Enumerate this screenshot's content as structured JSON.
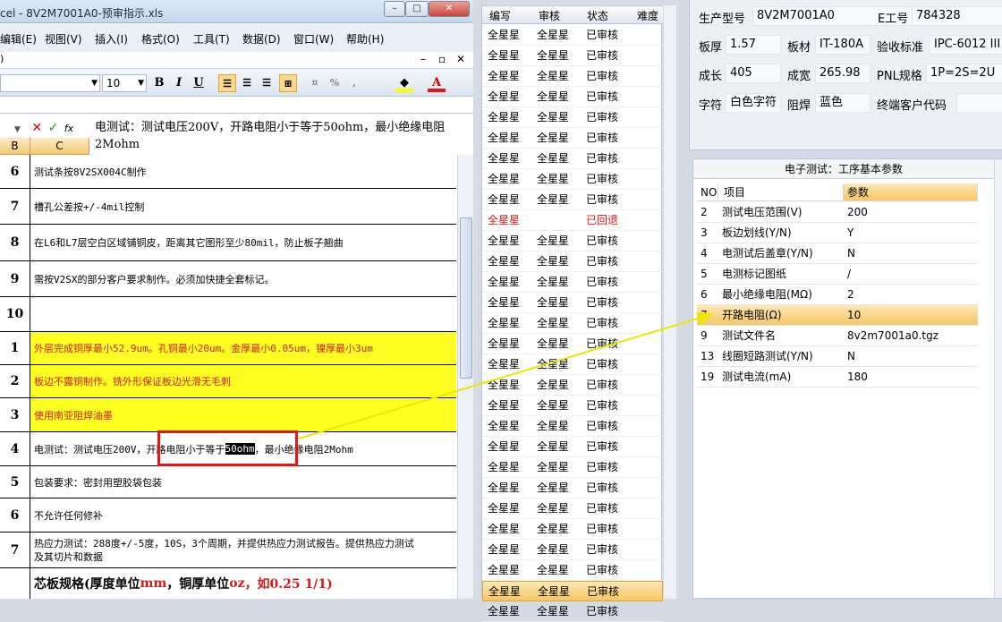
{
  "excel": {
    "title": "cel - 8V2M7001A0-预审指示.xls",
    "menus": [
      "编辑(E)",
      "视图(V)",
      "插入(I)",
      "格式(O)",
      "工具(T)",
      "数据(D)",
      "窗口(W)",
      "帮助(H)"
    ],
    "font_size": "10",
    "formula_text": "电测试：测试电压200V，开路电阻小于等于50ohm，最小绝缘电阻2Mohm",
    "col_b": "B",
    "col_c": "C",
    "rows": [
      {
        "num": "6",
        "text": "测试条按8V2SX004C制作"
      },
      {
        "num": "7",
        "text": "槽孔公差按+/-4mil控制"
      },
      {
        "num": "8",
        "text": "在L6和L7层空白区域铺铜皮，距离其它图形至少80mil，防止板子翘曲"
      },
      {
        "num": "9",
        "text": "需按V2SX的部分客户要求制作。必须加快捷全套标记。"
      },
      {
        "num": "10",
        "text": ""
      },
      {
        "num": "1",
        "text": "外层完成铜厚最小52.9um。孔铜最小20um。金厚最小0.05um，镍厚最小3um"
      },
      {
        "num": "2",
        "text": "板边不露铜制作。铣外形保证板边光滑无毛刺"
      },
      {
        "num": "3",
        "text": "使用南亚阻焊油墨"
      },
      {
        "num": "4",
        "text_a": "电测试：测试电压200V，开路电阻小于等于",
        "text_hl": "50ohm",
        "text_b": "，最小绝缘电阻2Mohm"
      },
      {
        "num": "5",
        "text": "包装要求：密封用塑胶袋包装"
      },
      {
        "num": "6",
        "text": "不允许任何修补"
      },
      {
        "num": "7",
        "text": "热应力测试：288度+/-5度，10S，3个周期，并提供热应力测试报告。提供热应力测试",
        "text2": "及其切片和数据"
      }
    ],
    "last_row_parts": [
      "芯板规格(厚度单位",
      "mm",
      "，铜厚单位",
      "oz",
      "，如0.25 1/1)"
    ]
  },
  "review": {
    "headers": [
      "编写",
      "审核",
      "状态",
      "难度"
    ],
    "rows": [
      {
        "writer": "全星星",
        "reviewer": "全星星",
        "status": "已审核"
      },
      {
        "writer": "全星星",
        "reviewer": "全星星",
        "status": "已审核"
      },
      {
        "writer": "全星星",
        "reviewer": "全星星",
        "status": "已审核"
      },
      {
        "writer": "全星星",
        "reviewer": "全星星",
        "status": "已审核"
      },
      {
        "writer": "全星星",
        "reviewer": "全星星",
        "status": "已审核"
      },
      {
        "writer": "全星星",
        "reviewer": "全星星",
        "status": "已审核"
      },
      {
        "writer": "全星星",
        "reviewer": "全星星",
        "status": "已审核"
      },
      {
        "writer": "全星星",
        "reviewer": "全星星",
        "status": "已审核"
      },
      {
        "writer": "全星星",
        "reviewer": "全星星",
        "status": "已审核"
      },
      {
        "writer": "全星星",
        "reviewer": "",
        "status": "已回退"
      },
      {
        "writer": "全星星",
        "reviewer": "全星星",
        "status": "已审核"
      },
      {
        "writer": "全星星",
        "reviewer": "全星星",
        "status": "已审核"
      },
      {
        "writer": "全星星",
        "reviewer": "全星星",
        "status": "已审核"
      },
      {
        "writer": "全星星",
        "reviewer": "全星星",
        "status": "已审核"
      },
      {
        "writer": "全星星",
        "reviewer": "全星星",
        "status": "已审核"
      },
      {
        "writer": "全星星",
        "reviewer": "全星星",
        "status": "已审核"
      },
      {
        "writer": "全星星",
        "reviewer": "全星星",
        "status": "已审核"
      },
      {
        "writer": "全星星",
        "reviewer": "全星星",
        "status": "已审核"
      },
      {
        "writer": "全星星",
        "reviewer": "全星星",
        "status": "已审核"
      },
      {
        "writer": "全星星",
        "reviewer": "全星星",
        "status": "已审核"
      },
      {
        "writer": "全星星",
        "reviewer": "全星星",
        "status": "已审核"
      },
      {
        "writer": "全星星",
        "reviewer": "全星星",
        "status": "已审核"
      },
      {
        "writer": "全星星",
        "reviewer": "全星星",
        "status": "已审核"
      },
      {
        "writer": "全星星",
        "reviewer": "全星星",
        "status": "已审核"
      },
      {
        "writer": "全星星",
        "reviewer": "全星星",
        "status": "已审核"
      },
      {
        "writer": "全星星",
        "reviewer": "全星星",
        "status": "已审核"
      },
      {
        "writer": "全星星",
        "reviewer": "全星星",
        "status": "已审核"
      },
      {
        "writer": "全星星",
        "reviewer": "全星星",
        "status": "已审核"
      },
      {
        "writer": "全星星",
        "reviewer": "全星星",
        "status": "已审核"
      }
    ],
    "selected_index": 27,
    "returned_color": "#e01818"
  },
  "info": {
    "model_label": "生产型号",
    "model": "8V2M7001A0",
    "eno_label": "E工号",
    "eno": "784328",
    "thick_label": "板厚",
    "thick": "1.57",
    "mat_label": "板材",
    "mat": "IT-180A",
    "std_label": "验收标准",
    "std": "IPC-6012 III",
    "len_label": "成长",
    "len": "405",
    "wid_label": "成宽",
    "wid": "265.98",
    "pnl_label": "PNL规格",
    "pnl": "1P=2S=2U",
    "char_label": "字符",
    "char": "白色字符",
    "mask_label": "阻焊",
    "mask": "蓝色",
    "cust_label": "终端客户代码",
    "cust": ""
  },
  "params": {
    "title": "电子测试：工序基本参数",
    "headers": [
      "NO",
      "项目",
      "参数"
    ],
    "rows": [
      {
        "no": "2",
        "item": "测试电压范围(V)",
        "value": "200"
      },
      {
        "no": "3",
        "item": "板边划线(Y/N)",
        "value": "Y"
      },
      {
        "no": "4",
        "item": "电测试后盖章(Y/N)",
        "value": "N"
      },
      {
        "no": "5",
        "item": "电测标记图纸",
        "value": "/"
      },
      {
        "no": "6",
        "item": "最小绝缘电阻(MΩ)",
        "value": "2"
      },
      {
        "no": "7",
        "item": "开路电阻(Ω)",
        "value": "10"
      },
      {
        "no": "9",
        "item": "测试文件名",
        "value": "8v2m7001a0.tgz"
      },
      {
        "no": "13",
        "item": "线圈短路测试(Y/N)",
        "value": "N"
      },
      {
        "no": "19",
        "item": "测试电流(mA)",
        "value": "180"
      }
    ],
    "selected_index": 5
  },
  "colors": {
    "highlight_yellow": "#ffff22",
    "selection_orange": "#f7c765",
    "alert_red": "#e01818",
    "arrow": "#e8e800"
  }
}
